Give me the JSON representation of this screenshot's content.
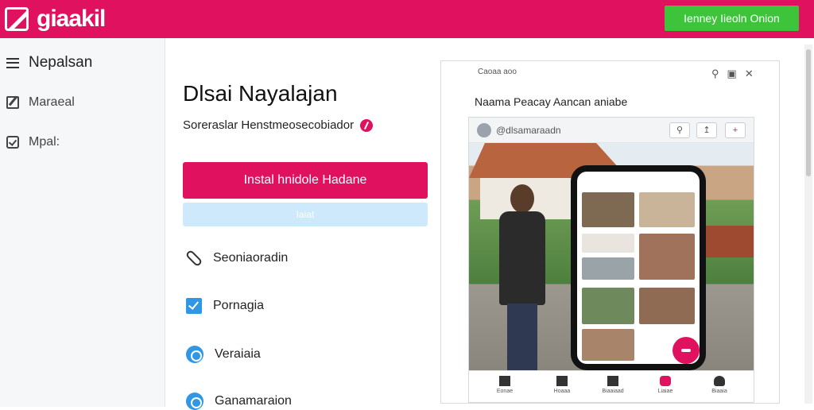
{
  "brand": {
    "logo_text": "giaakil"
  },
  "header": {
    "action_label": "Ienney Iieoln Onion"
  },
  "sidebar": {
    "title": "Nepalsan",
    "items": [
      {
        "label": "Maraeal",
        "icon": "pencil-icon"
      },
      {
        "label": "Mpal:",
        "icon": "checkbox-icon"
      }
    ]
  },
  "main": {
    "title": "Dlsai Nayalajan",
    "subtitle": "Soreraslar Henstmeosecobiador",
    "primary_button": "Instal hnidole Hadane",
    "secondary_button": "Iaiat",
    "features": [
      {
        "label": "Seoniaoradin",
        "icon": "link-icon"
      },
      {
        "label": "Pornagia",
        "icon": "checkbox-icon"
      },
      {
        "label": "Veraiaia",
        "icon": "globe-icon"
      },
      {
        "label": "Ganamaraion",
        "icon": "globe-icon"
      }
    ]
  },
  "preview": {
    "top_label": "Caoaa aoo",
    "heading": "Naama Peacay Aancan aniabe",
    "profile_name": "@dlsamaraadn",
    "tabs": [
      "Eonae",
      "Hoaaa",
      "Biaaiaad",
      "Liaiae",
      "Biaaia"
    ]
  },
  "colors": {
    "brand": "#e0115f",
    "action": "#3ec43a",
    "accent_blue": "#2f97e4"
  }
}
